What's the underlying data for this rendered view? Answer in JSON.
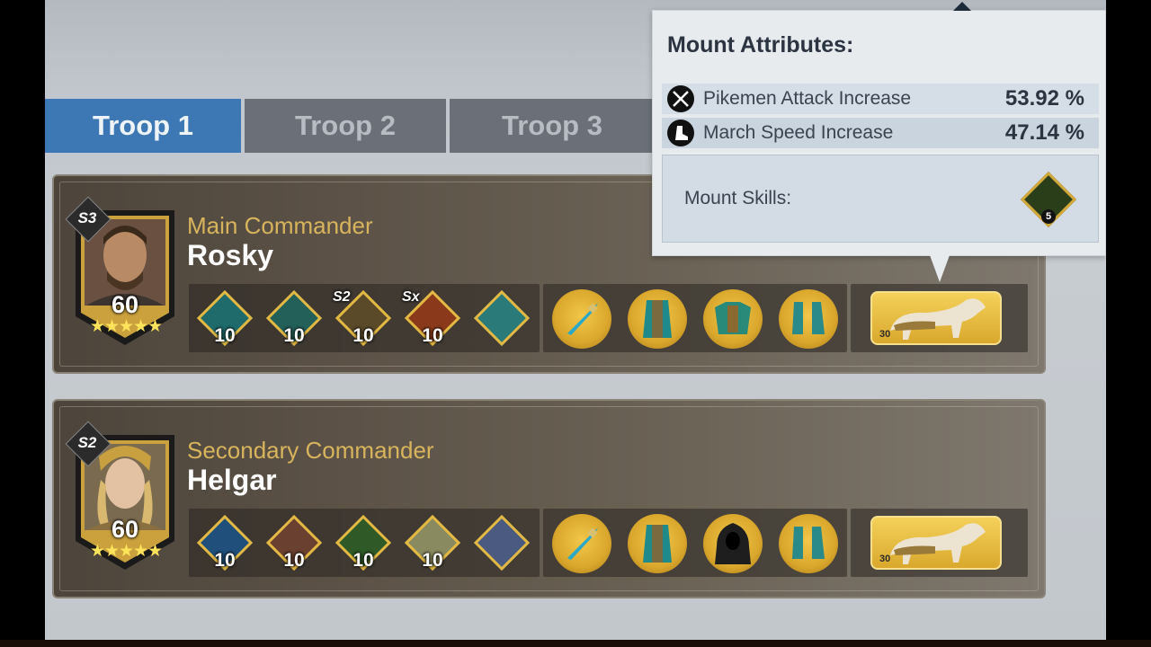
{
  "tabs": [
    {
      "label": "Troop 1",
      "active": true
    },
    {
      "label": "Troop 2",
      "active": false
    },
    {
      "label": "Troop 3",
      "active": false
    }
  ],
  "commanders": [
    {
      "role": "Main Commander",
      "name": "Rosky",
      "season": "S3",
      "level": "60",
      "stars": 5,
      "skills": [
        {
          "level": "10",
          "badge": "",
          "color": "#1f6b6b"
        },
        {
          "level": "10",
          "badge": "",
          "color": "#23605a"
        },
        {
          "level": "10",
          "badge": "S2",
          "color": "#5a4a2a"
        },
        {
          "level": "10",
          "badge": "Sx",
          "color": "#8a3a1a"
        },
        {
          "level": "",
          "badge": "",
          "color": "#2a7a7a"
        }
      ],
      "equipment": [
        "spear-icon",
        "armor-cape-icon",
        "chest-armor-icon",
        "boots-icon"
      ],
      "mount_level": "30"
    },
    {
      "role": "Secondary Commander",
      "name": "Helgar",
      "season": "S2",
      "level": "60",
      "stars": 5,
      "skills": [
        {
          "level": "10",
          "badge": "",
          "color": "#1f4f7a"
        },
        {
          "level": "10",
          "badge": "",
          "color": "#6a4030"
        },
        {
          "level": "10",
          "badge": "",
          "color": "#2f5a28"
        },
        {
          "level": "10",
          "badge": "",
          "color": "#8a8a60"
        },
        {
          "level": "",
          "badge": "",
          "color": "#4a5a80"
        }
      ],
      "equipment": [
        "spear-icon",
        "armor-cape-icon",
        "hood-cloak-icon",
        "boots-icon"
      ],
      "mount_level": "30"
    }
  ],
  "tooltip": {
    "title": "Mount Attributes:",
    "attributes": [
      {
        "icon": "crossed-spears-icon",
        "label": "Pikemen Attack Increase",
        "value": "53.92 %"
      },
      {
        "icon": "speed-boot-icon",
        "label": "March Speed Increase",
        "value": "47.14 %"
      }
    ],
    "skills_label": "Mount Skills:",
    "mount_skill_level": "5"
  }
}
